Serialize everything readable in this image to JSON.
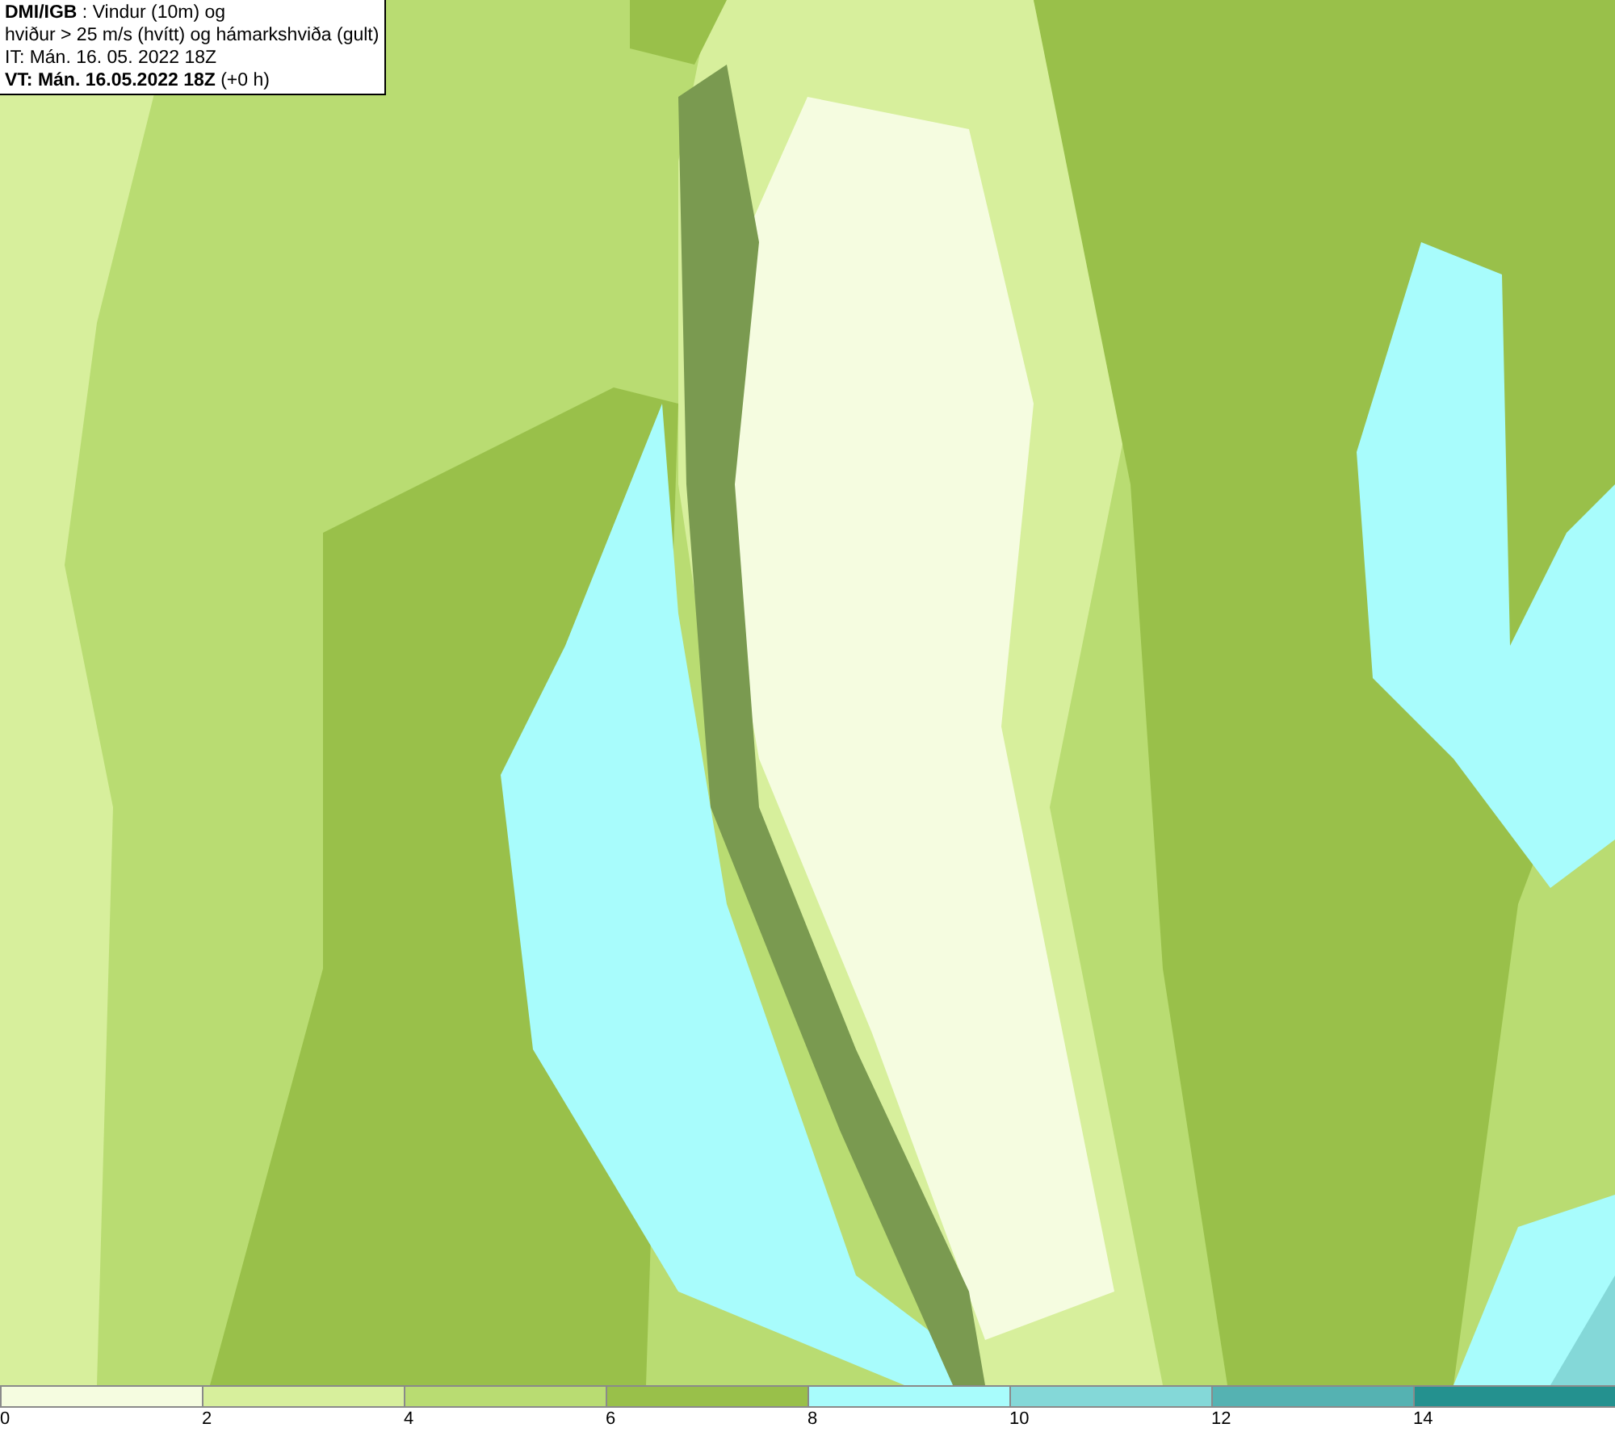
{
  "info_box": {
    "lines": [
      "**DMI/IGB** : Vindur (10m) og",
      "hviður > 25 m/s (hvítt) og hámarkshviða (gult)",
      "IT: Mán. 16. 05. 2022 18Z",
      "**VT: Mán. 16.05.2022 18Z** (+0 h)"
    ]
  },
  "legend": {
    "bins": [
      {
        "label": "0",
        "color": "#f5fce0"
      },
      {
        "label": "2",
        "color": "#d7ef9c"
      },
      {
        "label": "4",
        "color": "#b9dc72"
      },
      {
        "label": "6",
        "color": "#99c04a"
      },
      {
        "label": "8",
        "color": "#a8fcfc"
      },
      {
        "label": "10",
        "color": "#84d8d8"
      },
      {
        "label": "12",
        "color": "#55b2b2"
      },
      {
        "label": "14",
        "color": "#24918f"
      }
    ]
  }
}
